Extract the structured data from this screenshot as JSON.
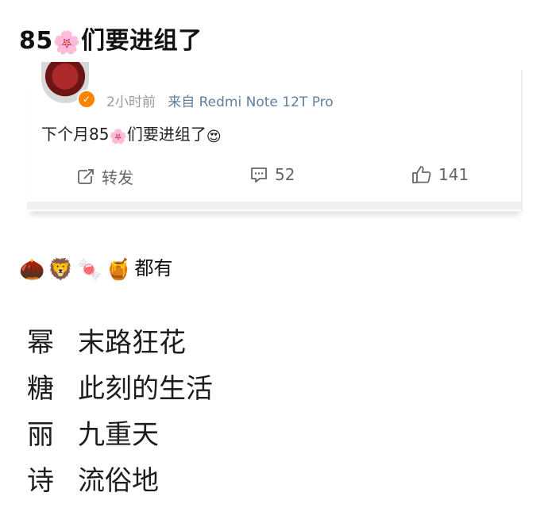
{
  "headline": {
    "text": "85",
    "emoji": "🌸",
    "suffix": "们要进组了"
  },
  "card": {
    "time": "2小时前",
    "source": "来自 Redmi Note 12T Pro",
    "post": {
      "prefix": "下个月85",
      "emoji": "🌸",
      "middle": "们要进组了",
      "emoji2": "😍"
    },
    "actions": {
      "repost_label": "转发",
      "comment_count": "52",
      "like_count": "141"
    }
  },
  "mid": {
    "emojis": [
      "🌰",
      "🦁",
      "🍬",
      "🍯"
    ],
    "text": "都有"
  },
  "list": [
    {
      "key": "幂",
      "value": "末路狂花"
    },
    {
      "key": "糖",
      "value": "此刻的生活"
    },
    {
      "key": "丽",
      "value": "九重天"
    },
    {
      "key": "诗",
      "value": "流俗地"
    }
  ],
  "colors": {
    "verified": "#ff8200",
    "source": "#5f7fa0",
    "meta": "#9a9a9a"
  },
  "icons": {
    "verified": "verified-badge-icon",
    "repost": "repost-icon",
    "comment": "comment-icon",
    "like": "thumbs-up-icon"
  }
}
